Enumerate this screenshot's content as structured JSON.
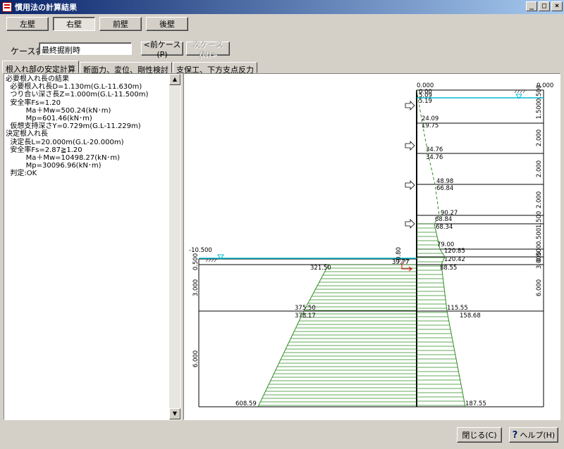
{
  "window": {
    "title": "慣用法の計算結果"
  },
  "wall_buttons": [
    "左壁",
    "右壁",
    "前壁",
    "後壁"
  ],
  "case": {
    "label": "ケース名",
    "value": "最終掘削時",
    "prev": "<前ケース(P)",
    "next": "次ケース(N)>"
  },
  "tabs": [
    "根入れ部の安定計算",
    "断面力、変位、剛性検討",
    "支保工、下方支点反力"
  ],
  "results": [
    "必要根入れ長の結果",
    "  必要根入れ長D=1.130m(G.L-11.630m)",
    "  つり合い深さ長Z=1.000m(G.L-11.500m)",
    "  安全率Fs=1.20",
    "         Ma＋Mw=500.24(kN･m)",
    "         Mp=601.46(kN･m)",
    "  仮想支持深さY=0.729m(G.L-11.229m)",
    "決定根入れ長",
    "  決定長L=20.000m(G.L-20.000m)",
    "  安全率Fs=2.87≧1.20",
    "         Ma＋Mw=10498.27(kN･m)",
    "         Mp=30096.96(kN･m)",
    "  判定:OK"
  ],
  "footer": {
    "close": "閉じる(C)",
    "help": "ヘルプ(H)"
  },
  "colors": {
    "water": "#00bcd4",
    "pressure": "#2e8b20",
    "support": "#d00000"
  },
  "diagram": {
    "top_left_level": "0.000",
    "top_right_level": "0.000",
    "excavation_level": "-10.500",
    "right_dims": [
      "0.500",
      "1.500",
      "2.000",
      "2.000",
      "2.000",
      "1.500",
      "0.500",
      "0.500",
      "3.000",
      "6.000"
    ],
    "left_dims": [
      "0.500",
      "3.000",
      "6.000"
    ],
    "active_labels": [
      "0.00",
      "5.09",
      "5.19",
      "24.09",
      "19.75",
      "34.76",
      "34.76",
      "48.98",
      "66.84",
      "90.27",
      "68.84",
      "68.34",
      "79.00",
      "120.85",
      "120.42",
      "88.55",
      "115.55",
      "158.68",
      "187.55"
    ],
    "passive_labels": [
      "321.50",
      "375.50",
      "378.17",
      "608.59"
    ],
    "misc_labels": [
      "0.80",
      "39.77"
    ]
  }
}
